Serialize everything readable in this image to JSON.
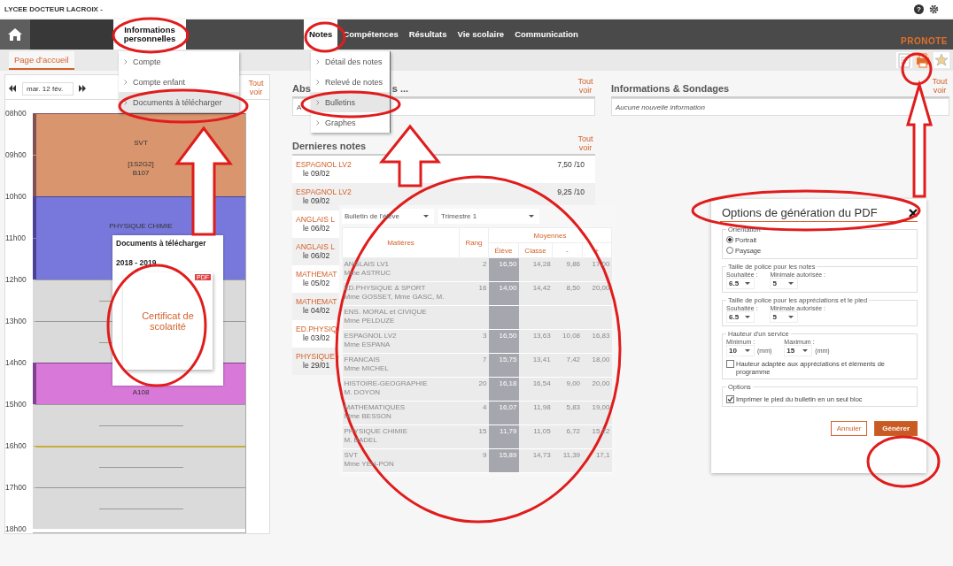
{
  "header": {
    "school": "LYCEE DOCTEUR LACROIX -",
    "help": "?"
  },
  "nav": {
    "items": [
      {
        "label": "Informations personnelles",
        "open": true
      },
      {
        "label": "Notes",
        "open": true
      },
      {
        "label": "Compétences",
        "open": false
      },
      {
        "label": "Résultats",
        "open": false
      },
      {
        "label": "Vie scolaire",
        "open": false
      },
      {
        "label": "Communication",
        "open": false
      }
    ],
    "logo": "PRONOTE"
  },
  "tabs": [
    {
      "label": "Page d'accueil",
      "selected": true
    }
  ],
  "toolbar": [
    {
      "kind": "document",
      "selected": false
    },
    {
      "kind": "pdf",
      "selected": true
    },
    {
      "kind": "star",
      "selected": false
    }
  ],
  "timetable": {
    "date": "mar. 12 fév.",
    "link": "Tout voir",
    "hours": [
      "08h00",
      "09h00",
      "10h00",
      "11h00",
      "12h00",
      "13h00",
      "14h00",
      "15h00",
      "16h00",
      "17h00",
      "18h00"
    ],
    "slots": [
      {
        "kind": "course",
        "color": "#d9956e",
        "start": true,
        "lines": [
          "SVT"
        ]
      },
      {
        "kind": "course",
        "color": "#d9956e",
        "start": false,
        "lines": [
          "[1S2G2]",
          "B107"
        ]
      },
      {
        "kind": "course",
        "color": "#7878dc",
        "start": true,
        "lines": [
          "PHYSIQUE CHIMIE"
        ]
      },
      {
        "kind": "course",
        "color": "#7878dc",
        "start": false
      },
      {
        "kind": "free",
        "current": false
      },
      {
        "kind": "free",
        "current": false
      },
      {
        "kind": "course",
        "color": "#d878d8",
        "start": true,
        "lines": [
          "A108"
        ]
      },
      {
        "kind": "free",
        "current": false
      },
      {
        "kind": "free",
        "current": true
      },
      {
        "kind": "free",
        "current": false
      }
    ]
  },
  "info_menu": {
    "items": [
      {
        "label": "Compte",
        "selected": false
      },
      {
        "label": "Compte enfant",
        "selected": false
      },
      {
        "label": "Documents à télécharger",
        "selected": true
      }
    ]
  },
  "notes_menu": {
    "items": [
      {
        "label": "Détail des notes",
        "selected": false
      },
      {
        "label": "Relevé de notes",
        "selected": false
      },
      {
        "label": "Bulletins",
        "selected": true
      },
      {
        "label": "Graphes",
        "selected": false
      }
    ]
  },
  "documents_popup": {
    "title": "Documents à télécharger",
    "year": "2018 - 2019",
    "badge": "PDF",
    "document": "Certificat de scolarité"
  },
  "absences": {
    "title_start": "Abs",
    "title_end": "s ...",
    "link": "Tout voir",
    "row": "A"
  },
  "latest_notes": {
    "title": "Dernieres notes",
    "link": "Tout voir",
    "rows": [
      {
        "subject": "ESPAGNOL LV2",
        "date": "le 09/02",
        "grade": "7,50 /10"
      },
      {
        "subject": "ESPAGNOL LV2",
        "date": "le 09/02",
        "grade": "9,25 /10"
      },
      {
        "subject": "ANGLAIS L",
        "date": "le 06/02"
      },
      {
        "subject": "ANGLAIS L",
        "date": "le 06/02"
      },
      {
        "subject": "MATHEMAT",
        "date": "le 05/02"
      },
      {
        "subject": "MATHEMAT",
        "date": "le 04/02"
      },
      {
        "subject": "ED.PHYSIQ",
        "date": "le 03/02"
      },
      {
        "subject": "PHYSIQUE -",
        "date": "le 29/01"
      }
    ]
  },
  "informations": {
    "title": "Informations & Sondages",
    "link": "Tout voir",
    "empty": "Aucune nouvelle information"
  },
  "report": {
    "selects": [
      "Bulletin de l'élève",
      "Trimestre 1"
    ],
    "columns": {
      "subject": "Matières",
      "rank": "Rang",
      "averages": "Moyennes",
      "student": "Élève",
      "class": "Classe",
      "min": "-",
      "max": "+"
    },
    "rows": [
      {
        "subject": "ANGLAIS LV1",
        "teacher": "Mme ASTRUC",
        "rank": "2",
        "student": "16,50",
        "class": "14,28",
        "min": "9,86",
        "max": "17,00"
      },
      {
        "subject": "ED.PHYSIQUE & SPORT",
        "teacher": "Mme GOSSET, Mme GASC, M.",
        "rank": "16",
        "student": "14,00",
        "class": "14,42",
        "min": "8,50",
        "max": "20,00"
      },
      {
        "subject": "ENS. MORAL et CIVIQUE",
        "teacher": "Mme PELDUZE"
      },
      {
        "subject": "ESPAGNOL LV2",
        "teacher": "Mme ESPANA",
        "rank": "3",
        "student": "16,50",
        "class": "13,63",
        "min": "10,08",
        "max": "16,83"
      },
      {
        "subject": "FRANCAIS",
        "teacher": "Mme MICHEL",
        "rank": "7",
        "student": "15,75",
        "class": "13,41",
        "min": "7,42",
        "max": "18,00"
      },
      {
        "subject": "HISTOIRE-GEOGRAPHIE",
        "teacher": "M. DOYON",
        "rank": "20",
        "student": "16,18",
        "class": "16,54",
        "min": "9,00",
        "max": "20,00"
      },
      {
        "subject": "MATHEMATIQUES",
        "teacher": "Mme BESSON",
        "rank": "4",
        "student": "16,07",
        "class": "11,98",
        "min": "5,83",
        "max": "19,00"
      },
      {
        "subject": "PHYSIQUE CHIMIE",
        "teacher": "M. BADEL",
        "rank": "15",
        "student": "11,79",
        "class": "11,05",
        "min": "6,72",
        "max": "15,22"
      },
      {
        "subject": "SVT",
        "teacher": "Mme YEN-PON",
        "rank": "9",
        "student": "15,89",
        "class": "14,73",
        "min": "11,39",
        "max": "17,1"
      }
    ]
  },
  "pdf_dialog": {
    "title": "Options de génération du PDF",
    "orientation": {
      "legend": "Orientation",
      "options": [
        {
          "label": "Portrait",
          "selected": true
        },
        {
          "label": "Paysage",
          "selected": false
        }
      ]
    },
    "groups": [
      {
        "legend": "Taille de police pour les notes",
        "fields": [
          {
            "label": "Souhaitée :",
            "value": "6.5"
          },
          {
            "label": "Minimale autorisée :",
            "value": "5"
          }
        ]
      },
      {
        "legend": "Taille de police pour les appréciations et le pied",
        "fields": [
          {
            "label": "Souhaitée :",
            "value": "6.5"
          },
          {
            "label": "Minimale autorisée :",
            "value": "5"
          }
        ]
      },
      {
        "legend": "Hauteur d'un service",
        "fields": [
          {
            "label": "Minimum :",
            "value": "10",
            "unit": "(mm)"
          },
          {
            "label": "Maximum :",
            "value": "15",
            "unit": "(mm)"
          }
        ],
        "checkbox": {
          "label": "Hauteur adaptée aux appréciations et éléments de programme",
          "checked": false
        }
      },
      {
        "legend": "Options",
        "checkbox": {
          "label": "Imprimer le pied du bulletin en un seul bloc",
          "checked": true
        }
      }
    ],
    "buttons": [
      {
        "label": "Annuler",
        "kind": "secondary"
      },
      {
        "label": "Générer",
        "kind": "primary"
      }
    ]
  }
}
